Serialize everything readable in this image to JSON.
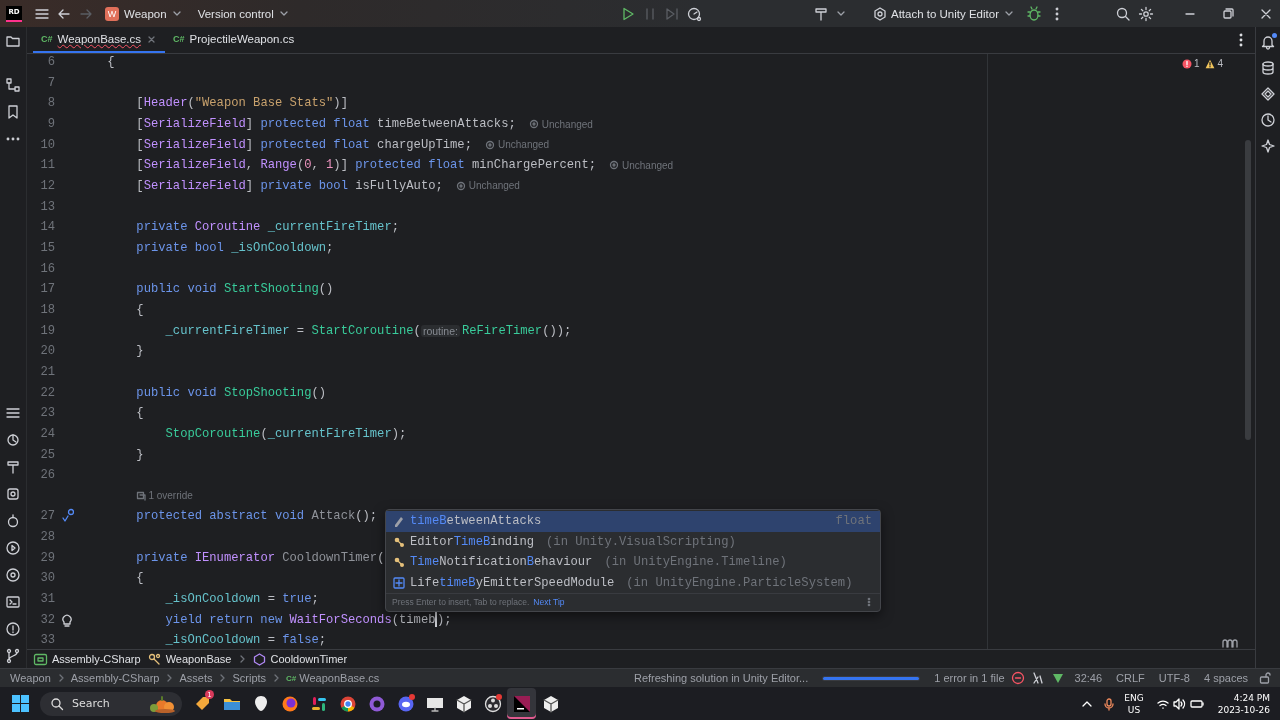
{
  "title_bar": {
    "logo": "RD",
    "project": {
      "badge": "W",
      "name": "Weapon"
    },
    "version_control": "Version control",
    "run_config": "Attach to Unity Editor"
  },
  "tabs": [
    {
      "file_type": "C#",
      "label": "WeaponBase.cs",
      "selected": true,
      "error": true
    },
    {
      "file_type": "C#",
      "label": "ProjectileWeapon.cs",
      "selected": false,
      "error": false
    }
  ],
  "inspections": {
    "errors": "1",
    "warnings": "4"
  },
  "lines": [
    {
      "kind": "code",
      "number": "6",
      "segments": [
        {
          "kind": "plain",
          "text": "    {"
        }
      ]
    },
    {
      "kind": "code",
      "number": "7"
    },
    {
      "kind": "code",
      "number": "8",
      "segments": [
        {
          "kind": "plain",
          "text": "        ["
        },
        {
          "kind": "attr",
          "text": "Header"
        },
        {
          "kind": "plain",
          "text": "("
        },
        {
          "kind": "string",
          "text": "\"Weapon Base Stats\""
        },
        {
          "kind": "plain",
          "text": ")]"
        }
      ]
    },
    {
      "kind": "code",
      "number": "9",
      "segments": [
        {
          "kind": "plain",
          "text": "        ["
        },
        {
          "kind": "attr",
          "text": "SerializeField"
        },
        {
          "kind": "plain",
          "text": "] "
        },
        {
          "kind": "kw",
          "text": "protected float"
        },
        {
          "kind": "plain",
          "text": " timeBetweenAttacks;"
        },
        {
          "kind": "hint",
          "text": "Unchanged"
        }
      ]
    },
    {
      "kind": "code",
      "number": "10",
      "segments": [
        {
          "kind": "plain",
          "text": "        ["
        },
        {
          "kind": "attr",
          "text": "SerializeField"
        },
        {
          "kind": "plain",
          "text": "] "
        },
        {
          "kind": "kw",
          "text": "protected float"
        },
        {
          "kind": "plain",
          "text": " chargeUpTime;"
        },
        {
          "kind": "hint",
          "text": "Unchanged"
        }
      ]
    },
    {
      "kind": "code",
      "number": "11",
      "segments": [
        {
          "kind": "plain",
          "text": "        ["
        },
        {
          "kind": "attr",
          "text": "SerializeField"
        },
        {
          "kind": "plain",
          "text": ", "
        },
        {
          "kind": "attr",
          "text": "Range"
        },
        {
          "kind": "plain",
          "text": "("
        },
        {
          "kind": "number",
          "text": "0"
        },
        {
          "kind": "plain",
          "text": ", "
        },
        {
          "kind": "number",
          "text": "1"
        },
        {
          "kind": "plain",
          "text": ")] "
        },
        {
          "kind": "kw",
          "text": "protected float"
        },
        {
          "kind": "plain",
          "text": " minChargePercent;"
        },
        {
          "kind": "hint",
          "text": "Unchanged"
        }
      ]
    },
    {
      "kind": "code",
      "number": "12",
      "segments": [
        {
          "kind": "plain",
          "text": "        ["
        },
        {
          "kind": "attr",
          "text": "SerializeField"
        },
        {
          "kind": "plain",
          "text": "] "
        },
        {
          "kind": "kw",
          "text": "private bool"
        },
        {
          "kind": "plain",
          "text": " isFullyAuto;"
        },
        {
          "kind": "hint",
          "text": "Unchanged"
        }
      ]
    },
    {
      "kind": "code",
      "number": "13"
    },
    {
      "kind": "code",
      "number": "14",
      "segments": [
        {
          "kind": "kw",
          "text": "        private "
        },
        {
          "kind": "type",
          "text": "Coroutine"
        },
        {
          "kind": "field",
          "text": " _currentFireTimer"
        },
        {
          "kind": "plain",
          "text": ";"
        }
      ]
    },
    {
      "kind": "code",
      "number": "15",
      "segments": [
        {
          "kind": "kw",
          "text": "        private bool "
        },
        {
          "kind": "field",
          "text": "_isOnCooldown"
        },
        {
          "kind": "plain",
          "text": ";"
        }
      ]
    },
    {
      "kind": "code",
      "number": "16"
    },
    {
      "kind": "code",
      "number": "17",
      "segments": [
        {
          "kind": "kw",
          "text": "        public void "
        },
        {
          "kind": "method",
          "text": "StartShooting"
        },
        {
          "kind": "plain",
          "text": "()"
        }
      ]
    },
    {
      "kind": "code",
      "number": "18",
      "segments": [
        {
          "kind": "plain",
          "text": "        {"
        }
      ]
    },
    {
      "kind": "code",
      "number": "19",
      "segments": [
        {
          "kind": "field",
          "text": "            _currentFireTimer"
        },
        {
          "kind": "plain",
          "text": " = "
        },
        {
          "kind": "method",
          "text": "StartCoroutine"
        },
        {
          "kind": "plain",
          "text": "("
        },
        {
          "kind": "inlay",
          "text": "routine:"
        },
        {
          "kind": "method",
          "text": "ReFireTimer"
        },
        {
          "kind": "plain",
          "text": "());"
        }
      ]
    },
    {
      "kind": "code",
      "number": "20",
      "segments": [
        {
          "kind": "plain",
          "text": "        }"
        }
      ]
    },
    {
      "kind": "code",
      "number": "21"
    },
    {
      "kind": "code",
      "number": "22",
      "segments": [
        {
          "kind": "kw",
          "text": "        public void "
        },
        {
          "kind": "method",
          "text": "StopShooting"
        },
        {
          "kind": "plain",
          "text": "()"
        }
      ]
    },
    {
      "kind": "code",
      "number": "23",
      "segments": [
        {
          "kind": "plain",
          "text": "        {"
        }
      ]
    },
    {
      "kind": "code",
      "number": "24",
      "segments": [
        {
          "kind": "method",
          "text": "            StopCoroutine"
        },
        {
          "kind": "plain",
          "text": "("
        },
        {
          "kind": "field",
          "text": "_currentFireTimer"
        },
        {
          "kind": "plain",
          "text": ");"
        }
      ]
    },
    {
      "kind": "code",
      "number": "25",
      "segments": [
        {
          "kind": "plain",
          "text": "        }"
        }
      ]
    },
    {
      "kind": "code",
      "number": "26"
    },
    {
      "kind": "codevision",
      "text": "1 override"
    },
    {
      "kind": "code",
      "number": "27",
      "gutter_icon": {
        "kind": "override"
      },
      "segments": [
        {
          "kind": "kw",
          "text": "        protected abstract void "
        },
        {
          "kind": "unused",
          "text": "Attack"
        },
        {
          "kind": "plain",
          "text": "();"
        }
      ]
    },
    {
      "kind": "code",
      "number": "28"
    },
    {
      "kind": "code",
      "number": "29",
      "segments": [
        {
          "kind": "kw",
          "text": "        private "
        },
        {
          "kind": "type",
          "text": "IEnumerator"
        },
        {
          "kind": "unused",
          "text": " CooldownTimer"
        },
        {
          "kind": "plain",
          "text": "("
        }
      ]
    },
    {
      "kind": "code",
      "number": "30",
      "segments": [
        {
          "kind": "plain",
          "text": "        {"
        }
      ]
    },
    {
      "kind": "code",
      "number": "31",
      "segments": [
        {
          "kind": "field",
          "text": "            _isOnCooldown"
        },
        {
          "kind": "plain",
          "text": " = "
        },
        {
          "kind": "kw",
          "text": "true"
        },
        {
          "kind": "plain",
          "text": ";"
        }
      ]
    },
    {
      "kind": "code",
      "number": "32",
      "gutter_icon": {
        "kind": "bulb"
      },
      "segments": [
        {
          "kind": "kw",
          "text": "            yield return new "
        },
        {
          "kind": "type",
          "text": "WaitForSeconds"
        },
        {
          "kind": "plain",
          "text": "(timeb"
        },
        {
          "kind": "caret"
        },
        {
          "kind": "plain",
          "text": ");"
        }
      ]
    },
    {
      "kind": "code",
      "number": "33",
      "segments": [
        {
          "kind": "field",
          "text": "            _isOnCooldown"
        },
        {
          "kind": "plain",
          "text": " = "
        },
        {
          "kind": "kw",
          "text": "false"
        },
        {
          "kind": "plain",
          "text": ";"
        }
      ]
    }
  ],
  "completion": {
    "items": [
      {
        "kind": "field",
        "selected": true,
        "name": [
          {
            "match": true,
            "text": "timeB"
          },
          {
            "match": false,
            "text": "etweenAttacks"
          }
        ],
        "type": "float"
      },
      {
        "kind": "class",
        "selected": false,
        "name": [
          {
            "match": false,
            "text": "Editor"
          },
          {
            "match": true,
            "text": "TimeB"
          },
          {
            "match": false,
            "text": "inding"
          }
        ],
        "location": "(in Unity.VisualScripting)"
      },
      {
        "kind": "class",
        "selected": false,
        "name": [
          {
            "match": true,
            "text": "Time"
          },
          {
            "match": false,
            "text": "Notification"
          },
          {
            "match": true,
            "text": "B"
          },
          {
            "match": false,
            "text": "ehaviour"
          }
        ],
        "location": "(in UnityEngine.Timeline)"
      },
      {
        "kind": "struct",
        "selected": false,
        "name": [
          {
            "match": false,
            "text": "Life"
          },
          {
            "match": true,
            "text": "timeB"
          },
          {
            "match": false,
            "text": "yEmitterSpeedModule"
          }
        ],
        "location": "(in UnityEngine.ParticleSystem)"
      }
    ],
    "hint": "Press Enter to insert, Tab to replace.",
    "tip_link": "Next Tip"
  },
  "breadcrumbs": [
    "Assembly-CSharp",
    "WeaponBase",
    "CooldownTimer"
  ],
  "status_bar": {
    "path": [
      "Weapon",
      "Assembly-CSharp",
      "Assets",
      "Scripts"
    ],
    "file_type": "C#",
    "file": "WeaponBase.cs",
    "task": "Refreshing solution in Unity Editor...",
    "level": 1,
    "problems": "1 error in 1 file",
    "position": "32:46",
    "line_endings": "CRLF",
    "encoding": "UTF-8",
    "indent": "4 spaces"
  },
  "taskbar": {
    "search": "Search",
    "apps": [
      {
        "kind": "tag",
        "selected": false,
        "alert": false,
        "badge": "1"
      },
      {
        "kind": "folder",
        "selected": false,
        "alert": false
      },
      {
        "kind": "alien",
        "selected": false,
        "alert": false
      },
      {
        "kind": "fox",
        "selected": false,
        "alert": false
      },
      {
        "kind": "hash",
        "selected": false,
        "alert": false
      },
      {
        "kind": "wheel",
        "selected": false,
        "alert": false
      },
      {
        "kind": "cat",
        "selected": false,
        "alert": false
      },
      {
        "kind": "chat",
        "selected": false,
        "alert": true
      },
      {
        "kind": "monitor",
        "selected": false,
        "alert": false
      },
      {
        "kind": "cube",
        "selected": false,
        "alert": false
      },
      {
        "kind": "record",
        "selected": false,
        "alert": true
      },
      {
        "kind": "ide",
        "selected": true,
        "alert": false
      },
      {
        "kind": "cube",
        "selected": false,
        "alert": false
      }
    ],
    "language": "ENG",
    "region": "US",
    "time": "4:24 PM",
    "date": "2023-10-26"
  }
}
